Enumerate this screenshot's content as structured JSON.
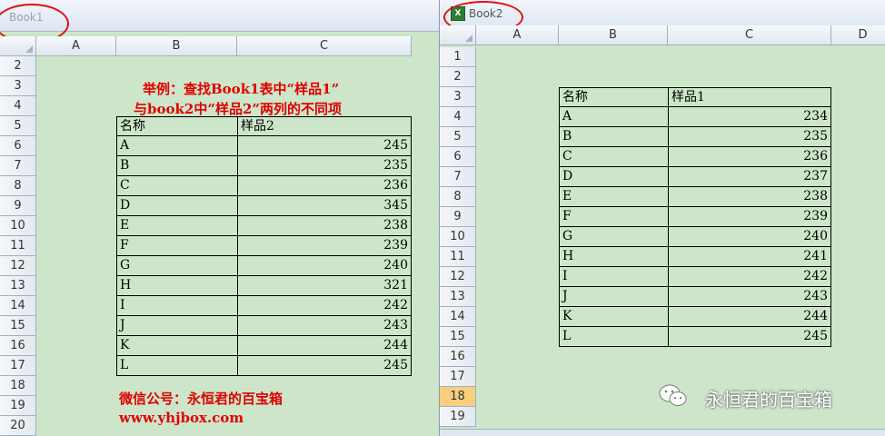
{
  "book1": {
    "title": "Book1",
    "columns": [
      "A",
      "B",
      "C"
    ],
    "rows": [
      "2",
      "3",
      "4",
      "5",
      "6",
      "7",
      "8",
      "9",
      "10",
      "11",
      "12",
      "13",
      "14",
      "15",
      "16",
      "17",
      "18",
      "19",
      "20"
    ],
    "note_line1": "举例：查找Book1表中“样品1”",
    "note_line2": "与book2中“样品2”两列的不同项",
    "table_header": [
      "名称",
      "样品2"
    ],
    "table": [
      [
        "A",
        "245"
      ],
      [
        "B",
        "235"
      ],
      [
        "C",
        "236"
      ],
      [
        "D",
        "345"
      ],
      [
        "E",
        "238"
      ],
      [
        "F",
        "239"
      ],
      [
        "G",
        "240"
      ],
      [
        "H",
        "321"
      ],
      [
        "I",
        "242"
      ],
      [
        "J",
        "243"
      ],
      [
        "K",
        "244"
      ],
      [
        "L",
        "245"
      ]
    ],
    "footer_line1": "微信公号：永恒君的百宝箱",
    "footer_line2": "www.yhjbox.com"
  },
  "book2": {
    "title": "Book2",
    "icon": "excel-icon",
    "columns": [
      "A",
      "B",
      "C",
      "D"
    ],
    "rows": [
      "1",
      "2",
      "3",
      "4",
      "5",
      "6",
      "7",
      "8",
      "9",
      "10",
      "11",
      "12",
      "13",
      "14",
      "15",
      "16",
      "17",
      "18",
      "19"
    ],
    "selected_row": "18",
    "table_header": [
      "名称",
      "样品1"
    ],
    "table": [
      [
        "A",
        "234"
      ],
      [
        "B",
        "235"
      ],
      [
        "C",
        "236"
      ],
      [
        "D",
        "237"
      ],
      [
        "E",
        "238"
      ],
      [
        "F",
        "239"
      ],
      [
        "G",
        "240"
      ],
      [
        "H",
        "241"
      ],
      [
        "I",
        "242"
      ],
      [
        "J",
        "243"
      ],
      [
        "K",
        "244"
      ],
      [
        "L",
        "245"
      ]
    ],
    "watermark": "永恒君的百宝箱"
  },
  "colors": {
    "grid_bg": "#cde6c9",
    "accent_red": "#e00000",
    "row_selected": "#f8cf7c"
  }
}
